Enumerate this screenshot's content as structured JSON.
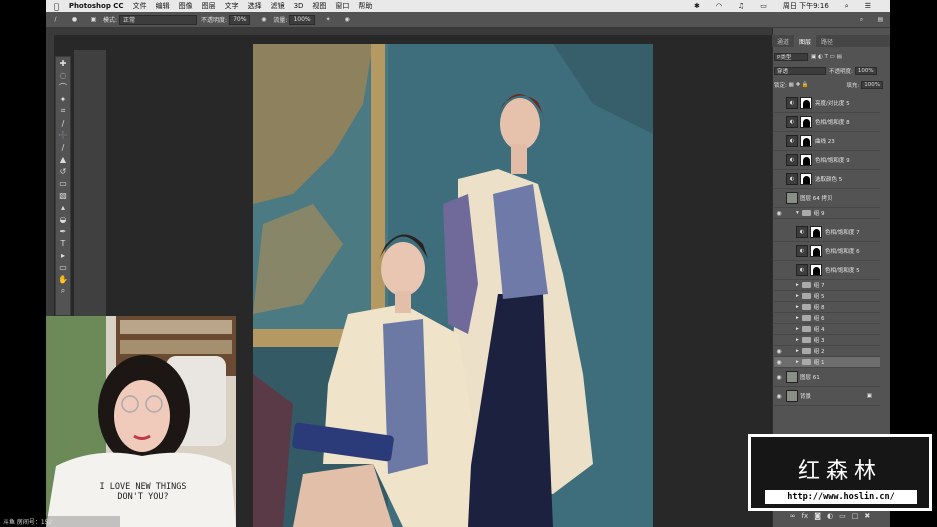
{
  "menubar": {
    "app_name": "Photoshop CC",
    "items": [
      "文件",
      "编辑",
      "图像",
      "图层",
      "文字",
      "选择",
      "滤镜",
      "3D",
      "视图",
      "窗口",
      "帮助"
    ],
    "clock": "周日 下午9:16"
  },
  "options_bar": {
    "mode_label": "模式:",
    "mode_value": "正常",
    "opacity_label": "不透明度:",
    "opacity_value": "70%",
    "flow_label": "流量:",
    "flow_value": "100%"
  },
  "panels": {
    "tabs": [
      "通道",
      "图层",
      "路径"
    ],
    "active_tab": "图层",
    "filter_kind": "P类型",
    "blend_mode": "穿透",
    "opacity_label": "不透明度:",
    "opacity_value": "100%",
    "lock_label": "锁定:",
    "fill_label": "填充:",
    "fill_value": "100%",
    "layers": [
      {
        "name": "亮度/对比度 5",
        "kind": "adj",
        "eye": false,
        "selected": false
      },
      {
        "name": "色相/饱和度 8",
        "kind": "adj",
        "eye": false,
        "selected": false
      },
      {
        "name": "曲线 23",
        "kind": "adj",
        "eye": false,
        "selected": false
      },
      {
        "name": "色相/饱和度 9",
        "kind": "adj",
        "eye": false,
        "selected": false
      },
      {
        "name": "选取颜色 5",
        "kind": "adj",
        "eye": false,
        "selected": false
      },
      {
        "name": "图层 64 拷贝",
        "kind": "pixel",
        "eye": false,
        "selected": false
      },
      {
        "name": "组 9",
        "kind": "group-open",
        "eye": true,
        "selected": false
      },
      {
        "name": "色相/饱和度 7",
        "kind": "adj-inner",
        "eye": false,
        "selected": false
      },
      {
        "name": "色相/饱和度 6",
        "kind": "adj-inner",
        "eye": false,
        "selected": false
      },
      {
        "name": "色相/饱和度 5",
        "kind": "adj-inner",
        "eye": false,
        "selected": false
      },
      {
        "name": "组 7",
        "kind": "group",
        "eye": false,
        "selected": false
      },
      {
        "name": "组 5",
        "kind": "group",
        "eye": false,
        "selected": false
      },
      {
        "name": "组 8",
        "kind": "group",
        "eye": false,
        "selected": false
      },
      {
        "name": "组 6",
        "kind": "group",
        "eye": false,
        "selected": false
      },
      {
        "name": "组 4",
        "kind": "group",
        "eye": false,
        "selected": false
      },
      {
        "name": "组 3",
        "kind": "group",
        "eye": false,
        "selected": false
      },
      {
        "name": "组 2",
        "kind": "group",
        "eye": true,
        "selected": false
      },
      {
        "name": "组 1",
        "kind": "group",
        "eye": true,
        "selected": true
      },
      {
        "name": "图层 61",
        "kind": "pixel",
        "eye": true,
        "selected": false
      },
      {
        "name": "背景",
        "kind": "pixel-bg",
        "eye": true,
        "selected": false
      }
    ]
  },
  "webcam": {
    "shirt_text_1": "I LOVE NEW THINGS",
    "shirt_text_2": "DON'T YOU?",
    "footer": "斗鱼 房间号：152"
  },
  "watermark": {
    "title": "红森林",
    "url": "http://www.hoslin.cn/"
  }
}
